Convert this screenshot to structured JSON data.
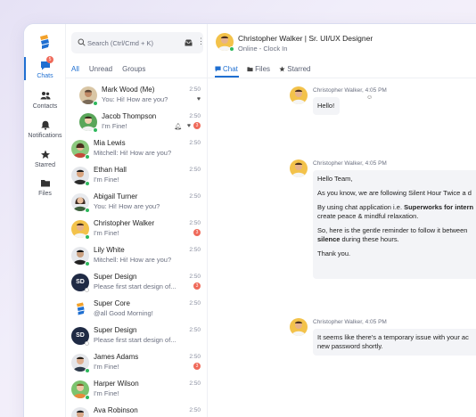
{
  "rail": {
    "items": [
      {
        "label": "Chats",
        "badge": "5"
      },
      {
        "label": "Contacts"
      },
      {
        "label": "Notifications"
      },
      {
        "label": "Starred"
      },
      {
        "label": "Files"
      }
    ]
  },
  "search": {
    "placeholder": "Search (Ctrl/Cmd + K)"
  },
  "filters": [
    "All",
    "Unread",
    "Groups"
  ],
  "chats": [
    {
      "name": "Mark Wood (Me)",
      "preview": "You: Hi! How are you?",
      "time": "2:50"
    },
    {
      "name": "Jacob Thompson",
      "preview": "I'm Fine!",
      "time": "2:50",
      "badge": "3"
    },
    {
      "name": "Mia Lewis",
      "preview": "Mitchell: Hi! How are you?",
      "time": "2:50"
    },
    {
      "name": "Ethan Hall",
      "preview": "I'm Fine!",
      "time": "2:50"
    },
    {
      "name": "Abigail Turner",
      "preview": "You: Hi! How are you?",
      "time": "2:50"
    },
    {
      "name": "Christopher Walker",
      "preview": "I'm Fine!",
      "time": "2:50",
      "badge": "3"
    },
    {
      "name": "Lily White",
      "preview": "Mitchell: Hi! How are you?",
      "time": "2:50"
    },
    {
      "name": "Super Design",
      "preview": "Please first start design of...",
      "time": "2:50",
      "badge": "3",
      "initials": "SD"
    },
    {
      "name": "Super Core",
      "preview": "@all Good Morning!",
      "time": "2:50"
    },
    {
      "name": "Super Design",
      "preview": "Please first start design of...",
      "time": "2:50",
      "initials": "SD"
    },
    {
      "name": "James Adams",
      "preview": "I'm Fine!",
      "time": "2:50",
      "badge": "3"
    },
    {
      "name": "Harper Wilson",
      "preview": "I'm Fine!",
      "time": "2:50"
    },
    {
      "name": "Ava Robinson",
      "preview": "",
      "time": "2:50"
    }
  ],
  "header": {
    "title": "Christopher Walker | Sr. UI/UX Designer",
    "status": "Online - Clock In"
  },
  "tabs": [
    "Chat",
    "Files",
    "Starred"
  ],
  "messages": [
    {
      "meta": "Christopher Walker, 4:05 PM",
      "lines": [
        "Hello!"
      ]
    },
    {
      "meta": "Christopher Walker, 4:05 PM",
      "lines": [
        "Hello Team,",
        "As you know, we are following Silent Hour Twice a d",
        "By using chat application i.e. ",
        "Superworks for intern",
        "create peace & mindful relaxation.",
        "So, here is the gentle reminder to follow it between",
        "silence",
        " during these hours.",
        "Thank you."
      ]
    },
    {
      "meta": "Christopher Walker, 4:05 PM",
      "lines": [
        "It seems like there's a temporary issue with your ac",
        "new password shortly."
      ]
    }
  ],
  "colors": {
    "accent": "#1f6fd1",
    "badge": "#ef6a5a",
    "online": "#2eb85c"
  }
}
